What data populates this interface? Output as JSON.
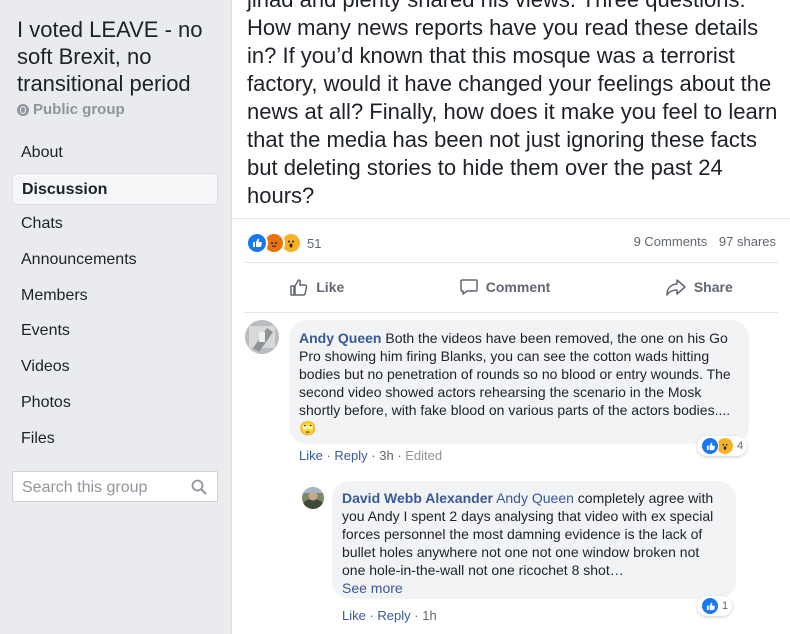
{
  "sidebar": {
    "group_title": "I voted LEAVE - no soft Brexit, no transitional period",
    "group_type": "Public group",
    "nav": [
      {
        "label": "About"
      },
      {
        "label": "Discussion"
      },
      {
        "label": "Chats"
      },
      {
        "label": "Announcements"
      },
      {
        "label": "Members"
      },
      {
        "label": "Events"
      },
      {
        "label": "Videos"
      },
      {
        "label": "Photos"
      },
      {
        "label": "Files"
      }
    ],
    "search_placeholder": "Search this group"
  },
  "post": {
    "text": "jihad and plenty shared his views.  Three questions: How many news reports have you read these details in? If you’d known that this mosque was a terrorist factory, would it have changed your feelings about the news at all? Finally, how does it make you feel to learn that the media has been not just ignoring these facts but deleting stories to hide them over the past 24 hours?",
    "reaction_count": "51",
    "comments_count": "9 Comments",
    "shares_count": "97 shares",
    "actions": {
      "like": "Like",
      "comment": "Comment",
      "share": "Share"
    }
  },
  "comments": [
    {
      "author": "Andy Queen",
      "text": " Both the videos have been removed, the one on his Go Pro showing him firing Blanks, you can see the cotton wads hitting bodies but no penetration of rounds so no blood or entry wounds. The second video showed actors rehearsing the scenario in the Mosk shortly before, with fake blood on various parts of the actors bodies....",
      "emoji": "🙄",
      "like": "Like",
      "reply": "Reply",
      "time": "3h",
      "edited": "Edited",
      "reactions": "4"
    },
    {
      "author": "David Webb Alexander",
      "mention": "Andy Queen",
      "text": " completely agree with you Andy I spent 2 days analysing that video with ex special forces personnel the most damning evidence is the lack of bullet holes anywhere not one not one window broken not one hole-in-the-wall not one ricochet 8 shot…",
      "see_more": "See more",
      "like": "Like",
      "reply": "Reply",
      "time": "1h",
      "reactions": "1"
    }
  ],
  "colors": {
    "link": "#385898",
    "like_blue": "#1877f2",
    "angry_orange": "#e9710f",
    "wow_yellow": "#f7b125"
  }
}
